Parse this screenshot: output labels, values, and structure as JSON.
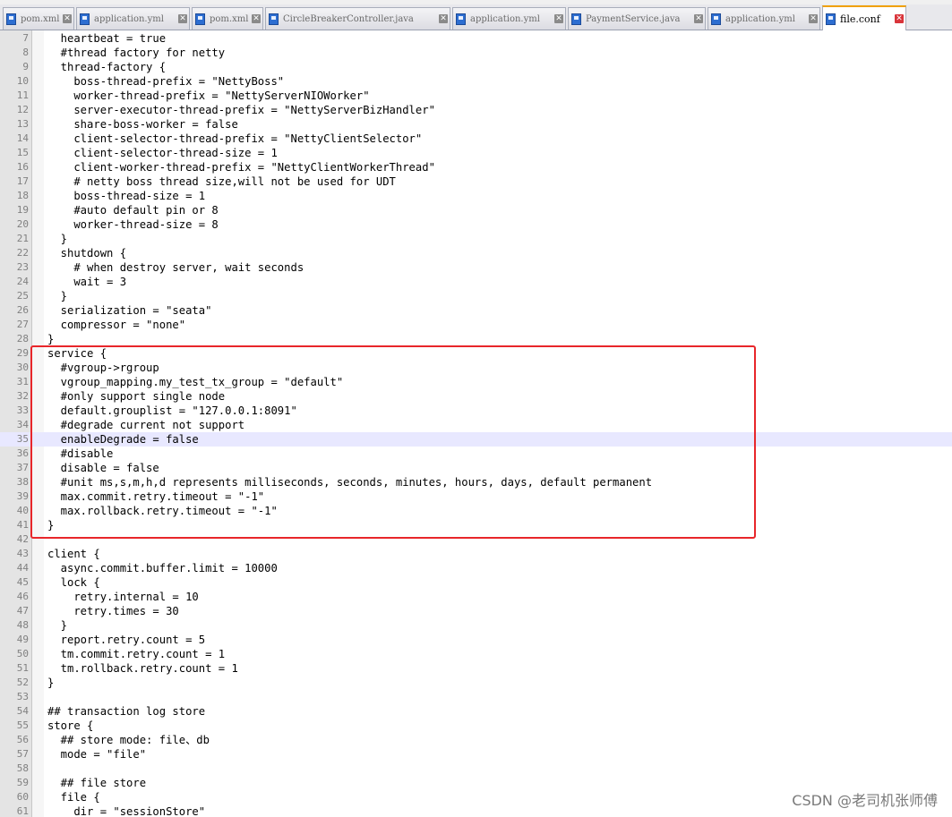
{
  "tabs": [
    {
      "label": "pom.xml",
      "active": false
    },
    {
      "label": "application.yml",
      "active": false
    },
    {
      "label": "pom.xml",
      "active": false
    },
    {
      "label": "CircleBreakerController.java",
      "active": false
    },
    {
      "label": "application.yml",
      "active": false
    },
    {
      "label": "PaymentService.java",
      "active": false
    },
    {
      "label": "application.yml",
      "active": false
    },
    {
      "label": "file.conf",
      "active": true
    }
  ],
  "close_glyph": "✕",
  "editor": {
    "current_line": 35,
    "lines": [
      {
        "no": "7",
        "text": "  heartbeat = true"
      },
      {
        "no": "8",
        "text": "  #thread factory for netty"
      },
      {
        "no": "9",
        "text": "  thread-factory {"
      },
      {
        "no": "10",
        "text": "    boss-thread-prefix = \"NettyBoss\""
      },
      {
        "no": "11",
        "text": "    worker-thread-prefix = \"NettyServerNIOWorker\""
      },
      {
        "no": "12",
        "text": "    server-executor-thread-prefix = \"NettyServerBizHandler\""
      },
      {
        "no": "13",
        "text": "    share-boss-worker = false"
      },
      {
        "no": "14",
        "text": "    client-selector-thread-prefix = \"NettyClientSelector\""
      },
      {
        "no": "15",
        "text": "    client-selector-thread-size = 1"
      },
      {
        "no": "16",
        "text": "    client-worker-thread-prefix = \"NettyClientWorkerThread\""
      },
      {
        "no": "17",
        "text": "    # netty boss thread size,will not be used for UDT"
      },
      {
        "no": "18",
        "text": "    boss-thread-size = 1"
      },
      {
        "no": "19",
        "text": "    #auto default pin or 8"
      },
      {
        "no": "20",
        "text": "    worker-thread-size = 8"
      },
      {
        "no": "21",
        "text": "  }"
      },
      {
        "no": "22",
        "text": "  shutdown {"
      },
      {
        "no": "23",
        "text": "    # when destroy server, wait seconds"
      },
      {
        "no": "24",
        "text": "    wait = 3"
      },
      {
        "no": "25",
        "text": "  }"
      },
      {
        "no": "26",
        "text": "  serialization = \"seata\""
      },
      {
        "no": "27",
        "text": "  compressor = \"none\""
      },
      {
        "no": "28",
        "text": "}"
      },
      {
        "no": "29",
        "text": "service {"
      },
      {
        "no": "30",
        "text": "  #vgroup->rgroup"
      },
      {
        "no": "31",
        "text": "  vgroup_mapping.my_test_tx_group = \"default\""
      },
      {
        "no": "32",
        "text": "  #only support single node"
      },
      {
        "no": "33",
        "text": "  default.grouplist = \"127.0.0.1:8091\""
      },
      {
        "no": "34",
        "text": "  #degrade current not support"
      },
      {
        "no": "35",
        "text": "  enableDegrade = false"
      },
      {
        "no": "36",
        "text": "  #disable"
      },
      {
        "no": "37",
        "text": "  disable = false"
      },
      {
        "no": "38",
        "text": "  #unit ms,s,m,h,d represents milliseconds, seconds, minutes, hours, days, default permanent"
      },
      {
        "no": "39",
        "text": "  max.commit.retry.timeout = \"-1\""
      },
      {
        "no": "40",
        "text": "  max.rollback.retry.timeout = \"-1\""
      },
      {
        "no": "41",
        "text": "}"
      },
      {
        "no": "42",
        "text": ""
      },
      {
        "no": "43",
        "text": "client {"
      },
      {
        "no": "44",
        "text": "  async.commit.buffer.limit = 10000"
      },
      {
        "no": "45",
        "text": "  lock {"
      },
      {
        "no": "46",
        "text": "    retry.internal = 10"
      },
      {
        "no": "47",
        "text": "    retry.times = 30"
      },
      {
        "no": "48",
        "text": "  }"
      },
      {
        "no": "49",
        "text": "  report.retry.count = 5"
      },
      {
        "no": "50",
        "text": "  tm.commit.retry.count = 1"
      },
      {
        "no": "51",
        "text": "  tm.rollback.retry.count = 1"
      },
      {
        "no": "52",
        "text": "}"
      },
      {
        "no": "53",
        "text": ""
      },
      {
        "no": "54",
        "text": "## transaction log store"
      },
      {
        "no": "55",
        "text": "store {"
      },
      {
        "no": "56",
        "text": "  ## store mode: file、db"
      },
      {
        "no": "57",
        "text": "  mode = \"file\""
      },
      {
        "no": "58",
        "text": ""
      },
      {
        "no": "59",
        "text": "  ## file store"
      },
      {
        "no": "60",
        "text": "  file {"
      },
      {
        "no": "61",
        "text": "    dir = \"sessionStore\""
      }
    ]
  },
  "watermark": "CSDN @老司机张师傅"
}
